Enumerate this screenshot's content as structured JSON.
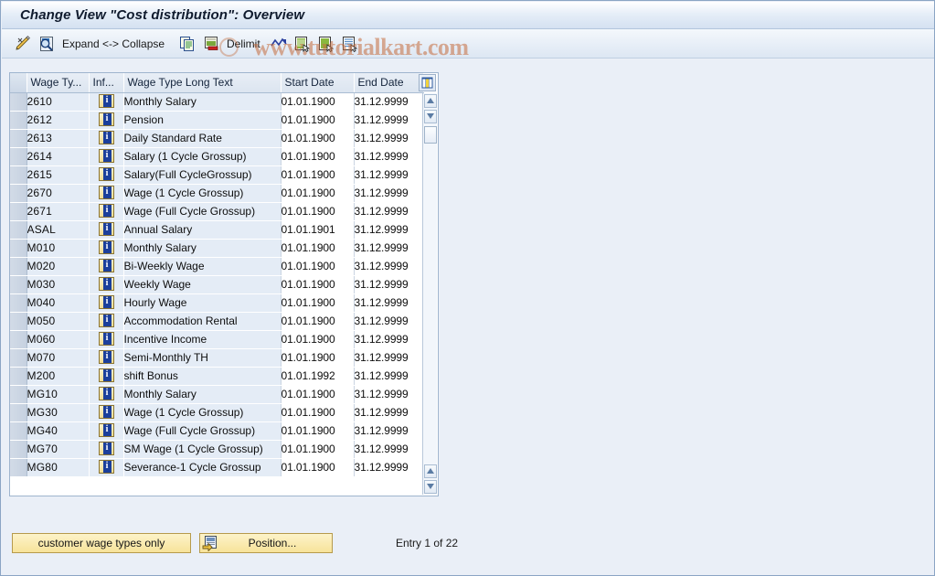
{
  "window": {
    "title": "Change View \"Cost distribution\": Overview"
  },
  "watermark": {
    "text": "www.tutorialkart.com"
  },
  "toolbar": {
    "items": [
      {
        "name": "display-change-icon",
        "icon": "pencil-icon",
        "label": ""
      },
      {
        "name": "display-icon",
        "icon": "magnifier-document-icon",
        "label": ""
      },
      {
        "name": "expand-collapse",
        "icon": "",
        "label": "Expand <-> Collapse"
      },
      {
        "name": "copy-as-icon",
        "icon": "copy-icon",
        "label": ""
      },
      {
        "name": "delete-icon",
        "icon": "delete-row-icon",
        "label": ""
      },
      {
        "name": "delimit",
        "icon": "",
        "label": "Delimit"
      },
      {
        "name": "undo-icon",
        "icon": "undo-arrow-icon",
        "label": ""
      },
      {
        "name": "select-all-icon",
        "icon": "select-all-icon",
        "label": ""
      },
      {
        "name": "deselect-all-icon",
        "icon": "deselect-all-icon",
        "label": ""
      },
      {
        "name": "details-icon",
        "icon": "details-icon",
        "label": ""
      }
    ],
    "expand_collapse_label": "Expand <-> Collapse",
    "delimit_label": "Delimit"
  },
  "table": {
    "columns": [
      {
        "key": "select",
        "label": ""
      },
      {
        "key": "wage_type",
        "label": "Wage Ty..."
      },
      {
        "key": "info",
        "label": "Inf..."
      },
      {
        "key": "long_text",
        "label": "Wage Type Long Text"
      },
      {
        "key": "start",
        "label": "Start Date"
      },
      {
        "key": "end",
        "label": "End Date"
      }
    ],
    "config_icon": "table-settings-icon",
    "rows": [
      {
        "wage_type": "2610",
        "info": "info-icon",
        "long_text": "Monthly Salary",
        "start": "01.01.1900",
        "end": "31.12.9999"
      },
      {
        "wage_type": "2612",
        "info": "info-icon",
        "long_text": "Pension",
        "start": "01.01.1900",
        "end": "31.12.9999"
      },
      {
        "wage_type": "2613",
        "info": "info-icon",
        "long_text": "Daily Standard Rate",
        "start": "01.01.1900",
        "end": "31.12.9999"
      },
      {
        "wage_type": "2614",
        "info": "info-icon",
        "long_text": "Salary (1 Cycle Grossup)",
        "start": "01.01.1900",
        "end": "31.12.9999"
      },
      {
        "wage_type": "2615",
        "info": "info-icon",
        "long_text": "Salary(Full CycleGrossup)",
        "start": "01.01.1900",
        "end": "31.12.9999"
      },
      {
        "wage_type": "2670",
        "info": "info-icon",
        "long_text": "Wage (1 Cycle Grossup)",
        "start": "01.01.1900",
        "end": "31.12.9999"
      },
      {
        "wage_type": "2671",
        "info": "info-icon",
        "long_text": "Wage (Full Cycle Grossup)",
        "start": "01.01.1900",
        "end": "31.12.9999"
      },
      {
        "wage_type": "ASAL",
        "info": "info-icon",
        "long_text": "Annual Salary",
        "start": "01.01.1901",
        "end": "31.12.9999"
      },
      {
        "wage_type": "M010",
        "info": "info-icon",
        "long_text": "Monthly Salary",
        "start": "01.01.1900",
        "end": "31.12.9999"
      },
      {
        "wage_type": "M020",
        "info": "info-icon",
        "long_text": "Bi-Weekly Wage",
        "start": "01.01.1900",
        "end": "31.12.9999"
      },
      {
        "wage_type": "M030",
        "info": "info-icon",
        "long_text": "Weekly Wage",
        "start": "01.01.1900",
        "end": "31.12.9999"
      },
      {
        "wage_type": "M040",
        "info": "info-icon",
        "long_text": "Hourly Wage",
        "start": "01.01.1900",
        "end": "31.12.9999"
      },
      {
        "wage_type": "M050",
        "info": "info-icon",
        "long_text": "Accommodation Rental",
        "start": "01.01.1900",
        "end": "31.12.9999"
      },
      {
        "wage_type": "M060",
        "info": "info-icon",
        "long_text": "Incentive Income",
        "start": "01.01.1900",
        "end": "31.12.9999"
      },
      {
        "wage_type": "M070",
        "info": "info-icon",
        "long_text": "Semi-Monthly TH",
        "start": "01.01.1900",
        "end": "31.12.9999"
      },
      {
        "wage_type": "M200",
        "info": "info-icon",
        "long_text": "shift Bonus",
        "start": "01.01.1992",
        "end": "31.12.9999"
      },
      {
        "wage_type": "MG10",
        "info": "info-icon",
        "long_text": "Monthly Salary",
        "start": "01.01.1900",
        "end": "31.12.9999"
      },
      {
        "wage_type": "MG30",
        "info": "info-icon",
        "long_text": "Wage (1 Cycle Grossup)",
        "start": "01.01.1900",
        "end": "31.12.9999"
      },
      {
        "wage_type": "MG40",
        "info": "info-icon",
        "long_text": "Wage (Full Cycle Grossup)",
        "start": "01.01.1900",
        "end": "31.12.9999"
      },
      {
        "wage_type": "MG70",
        "info": "info-icon",
        "long_text": "SM Wage (1 Cycle Grossup)",
        "start": "01.01.1900",
        "end": "31.12.9999"
      },
      {
        "wage_type": "MG80",
        "info": "info-icon",
        "long_text": "Severance-1 Cycle Grossup",
        "start": "01.01.1900",
        "end": "31.12.9999"
      }
    ]
  },
  "footer": {
    "customer_wage_types_label": "customer wage types only",
    "position_label": "Position...",
    "position_icon": "position-icon",
    "entry_status": "Entry 1 of 22"
  },
  "colors": {
    "title_text": "#101b2e",
    "table_row_bg": "#e4ecf6",
    "button_bg": "#f7e39a",
    "watermark": "#c46c3c"
  }
}
